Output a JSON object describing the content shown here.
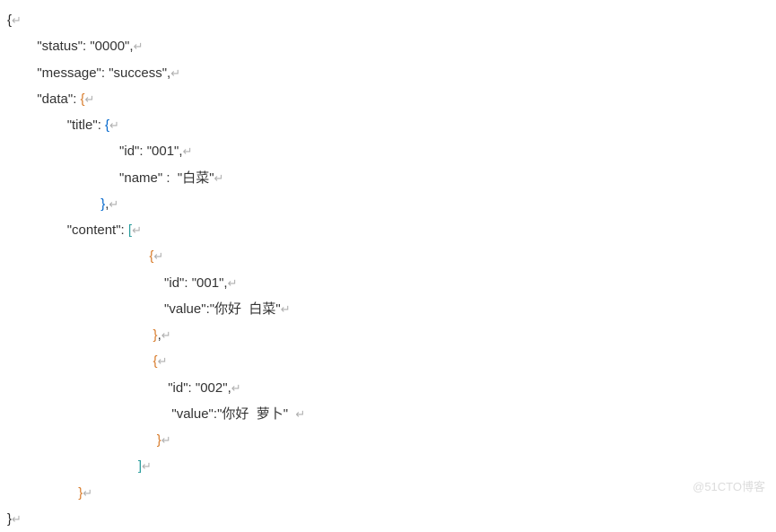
{
  "paragraph_symbol": "↵",
  "watermark": "@51CTO博客",
  "lines": [
    {
      "open_brace": "{",
      "open_class": "brace-dark"
    },
    {
      "indent": "        ",
      "key": "\"status\"",
      "sep": ": ",
      "val": "\"0000\"",
      "comma": ","
    },
    {
      "indent": "        ",
      "key": "\"message\"",
      "sep": ": ",
      "val": "\"success\"",
      "comma": ","
    },
    {
      "indent": "        ",
      "key": "\"data\"",
      "sep": ": ",
      "open_brace": "{",
      "open_class": "brace-orange"
    },
    {
      "indent": "                ",
      "key": "\"title\"",
      "sep": ": ",
      "open_brace": "{",
      "open_class": "brace-blue"
    },
    {
      "indent": "                              ",
      "key": "\"id\"",
      "sep": ": ",
      "val": "\"001\"",
      "comma": ","
    },
    {
      "indent": "                              ",
      "key": "\"name\" ",
      "sep": ": ",
      "val": " \"白菜\""
    },
    {
      "indent": "                         ",
      "close_brace": "}",
      "close_class": "brace-blue",
      "comma": ","
    },
    {
      "indent": "                ",
      "key": "\"content\"",
      "sep": ": ",
      "open_bracket": "[",
      "bracket_class": "bracket-teal"
    },
    {
      "indent": "                                      ",
      "open_brace": "{",
      "open_class": "brace-orange"
    },
    {
      "indent": "                                          ",
      "key": "\"id\"",
      "sep": ": ",
      "val": "\"001\"",
      "comma": ","
    },
    {
      "indent": "                                          ",
      "key": "\"value\"",
      "sep": ":",
      "val": "\"你好  白菜\""
    },
    {
      "indent": "                                       ",
      "close_brace": "}",
      "close_class": "brace-orange",
      "comma": ","
    },
    {
      "indent": "                                       ",
      "open_brace": "{",
      "open_class": "brace-orange"
    },
    {
      "indent": "                                           ",
      "key": "\"id\"",
      "sep": ": ",
      "val": "\"002\"",
      "comma": ","
    },
    {
      "indent": "                                            ",
      "key": "\"value\"",
      "sep": ":",
      "val": "\"你好  萝卜\"  "
    },
    {
      "indent": "                                        ",
      "close_brace": "}",
      "close_class": "brace-orange"
    },
    {
      "indent": "                                   ",
      "close_bracket": "]",
      "bracket_class": "bracket-teal"
    },
    {
      "indent": "                   ",
      "close_brace": "}",
      "close_class": "brace-orange"
    },
    {
      "close_brace": "}",
      "close_class": "brace-dark"
    }
  ]
}
